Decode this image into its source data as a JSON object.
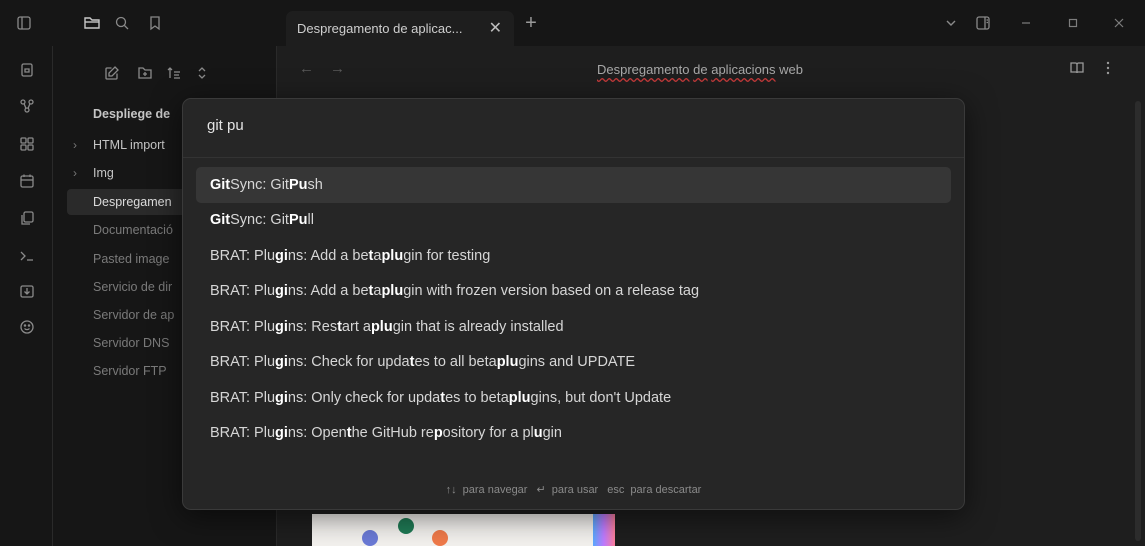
{
  "titlebar": {
    "tab_title": "Despregamento de aplicac...",
    "tab_close": "✕",
    "new_tab": "+"
  },
  "editor": {
    "back": "←",
    "forward": "→",
    "title_words": [
      "Despregamento",
      "de",
      "aplicacions",
      "web"
    ]
  },
  "sidebar": {
    "root": "Despliege de",
    "items": [
      {
        "label": "HTML import",
        "type": "folder"
      },
      {
        "label": "Img",
        "type": "folder"
      },
      {
        "label": "Despregamen",
        "type": "active"
      },
      {
        "label": "Documentació",
        "type": "file"
      },
      {
        "label": "Pasted image",
        "type": "file"
      },
      {
        "label": "Servicio de dir",
        "type": "file"
      },
      {
        "label": "Servidor de ap",
        "type": "file"
      },
      {
        "label": "Servidor DNS",
        "type": "file"
      },
      {
        "label": "Servidor FTP",
        "type": "file"
      }
    ]
  },
  "palette": {
    "query": "git pu",
    "results": [
      [
        [
          "Git",
          1
        ],
        [
          " Sync: Git ",
          0
        ],
        [
          "Pu",
          1
        ],
        [
          "sh",
          0
        ]
      ],
      [
        [
          "Git",
          1
        ],
        [
          " Sync: Git ",
          0
        ],
        [
          "Pu",
          1
        ],
        [
          "ll",
          0
        ]
      ],
      [
        [
          "BRAT: Plu",
          0
        ],
        [
          "gi",
          1
        ],
        [
          "ns: Add a be",
          0
        ],
        [
          "t",
          1
        ],
        [
          "a ",
          0
        ],
        [
          "plu",
          1
        ],
        [
          "gin for testing",
          0
        ]
      ],
      [
        [
          "BRAT: Plu",
          0
        ],
        [
          "gi",
          1
        ],
        [
          "ns: Add a be",
          0
        ],
        [
          "t",
          1
        ],
        [
          "a ",
          0
        ],
        [
          "plu",
          1
        ],
        [
          "gin with frozen version based on a release tag",
          0
        ]
      ],
      [
        [
          "BRAT: Plu",
          0
        ],
        [
          "gi",
          1
        ],
        [
          "ns: Res",
          0
        ],
        [
          "t",
          1
        ],
        [
          "art a ",
          0
        ],
        [
          "plu",
          1
        ],
        [
          "gin that is already installed",
          0
        ]
      ],
      [
        [
          "BRAT: Plu",
          0
        ],
        [
          "gi",
          1
        ],
        [
          "ns: Check for upda",
          0
        ],
        [
          "t",
          1
        ],
        [
          "es to all beta ",
          0
        ],
        [
          "plu",
          1
        ],
        [
          "gins and UPDATE",
          0
        ]
      ],
      [
        [
          "BRAT: Plu",
          0
        ],
        [
          "gi",
          1
        ],
        [
          "ns: Only check for upda",
          0
        ],
        [
          "t",
          1
        ],
        [
          "es to beta ",
          0
        ],
        [
          "plu",
          1
        ],
        [
          "gins, but don't Update",
          0
        ]
      ],
      [
        [
          "BRAT: Plu",
          0
        ],
        [
          "gi",
          1
        ],
        [
          "ns: Open ",
          0
        ],
        [
          "t",
          1
        ],
        [
          "he GitHub re",
          0
        ],
        [
          "p",
          1
        ],
        [
          "ository for a pl",
          0
        ],
        [
          "u",
          1
        ],
        [
          "gin",
          0
        ]
      ]
    ],
    "footer": {
      "nav_keys": "↑↓",
      "nav_label": "para navegar",
      "use_key": "↵",
      "use_label": "para usar",
      "esc_key": "esc",
      "esc_label": "para descartar"
    }
  },
  "colors": {
    "background": "#1e1e1e",
    "sidebar": "#161616",
    "palette": "#262626",
    "selected_row": "#363636",
    "spellcheck": "#c63a3a"
  }
}
